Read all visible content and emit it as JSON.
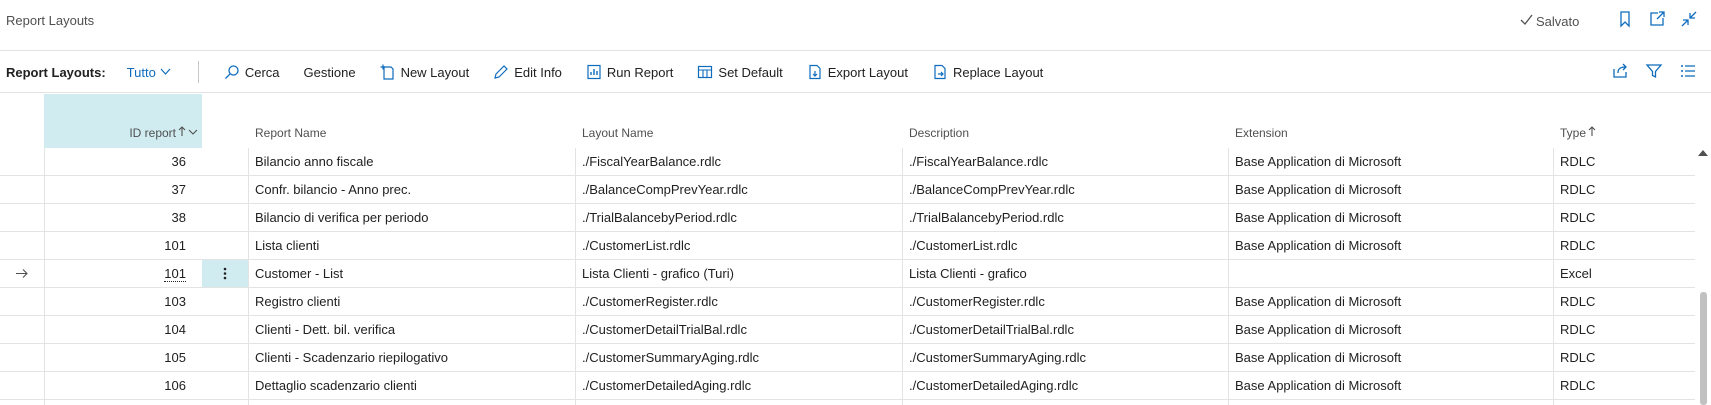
{
  "page": {
    "title": "Report Layouts",
    "saved_label": "Salvato"
  },
  "toolbar": {
    "caption": "Report Layouts:",
    "view": "Tutto",
    "actions": [
      "Cerca",
      "Gestione",
      "New Layout",
      "Edit Info",
      "Run Report",
      "Set Default",
      "Export Layout",
      "Replace Layout"
    ]
  },
  "columns": {
    "id": "ID report",
    "name": "Report Name",
    "layout": "Layout Name",
    "desc": "Description",
    "ext": "Extension",
    "type": "Type"
  },
  "rows": [
    {
      "id": "36",
      "name": "Bilancio anno fiscale",
      "layout": "./FiscalYearBalance.rdlc",
      "desc": "./FiscalYearBalance.rdlc",
      "ext": "Base Application di Microsoft",
      "type": "RDLC"
    },
    {
      "id": "37",
      "name": "Confr. bilancio - Anno prec.",
      "layout": "./BalanceCompPrevYear.rdlc",
      "desc": "./BalanceCompPrevYear.rdlc",
      "ext": "Base Application di Microsoft",
      "type": "RDLC"
    },
    {
      "id": "38",
      "name": "Bilancio di verifica per periodo",
      "layout": "./TrialBalancebyPeriod.rdlc",
      "desc": "./TrialBalancebyPeriod.rdlc",
      "ext": "Base Application di Microsoft",
      "type": "RDLC"
    },
    {
      "id": "101",
      "name": "Lista clienti",
      "layout": "./CustomerList.rdlc",
      "desc": "./CustomerList.rdlc",
      "ext": "Base Application di Microsoft",
      "type": "RDLC"
    },
    {
      "id": "101",
      "name": "Customer - List",
      "layout": "Lista Clienti - grafico (Turi)",
      "desc": "Lista Clienti - grafico",
      "ext": "",
      "type": "Excel"
    },
    {
      "id": "103",
      "name": "Registro clienti",
      "layout": "./CustomerRegister.rdlc",
      "desc": "./CustomerRegister.rdlc",
      "ext": "Base Application di Microsoft",
      "type": "RDLC"
    },
    {
      "id": "104",
      "name": "Clienti - Dett. bil. verifica",
      "layout": "./CustomerDetailTrialBal.rdlc",
      "desc": "./CustomerDetailTrialBal.rdlc",
      "ext": "Base Application di Microsoft",
      "type": "RDLC"
    },
    {
      "id": "105",
      "name": "Clienti - Scadenzario riepilogativo",
      "layout": "./CustomerSummaryAging.rdlc",
      "desc": "./CustomerSummaryAging.rdlc",
      "ext": "Base Application di Microsoft",
      "type": "RDLC"
    },
    {
      "id": "106",
      "name": "Dettaglio scadenzario clienti",
      "layout": "./CustomerDetailedAging.rdlc",
      "desc": "./CustomerDetailedAging.rdlc",
      "ext": "Base Application di Microsoft",
      "type": "RDLC"
    }
  ],
  "colors": {
    "accent": "#0f6cbd",
    "selected": "#d0ecf0",
    "border": "#e3e3e3"
  },
  "icons": [
    "checkmark-icon",
    "bookmark-icon",
    "open-new-window-icon",
    "collapse-icon",
    "search-icon",
    "new-document-icon",
    "edit-icon",
    "run-report-icon",
    "set-default-icon",
    "export-icon",
    "replace-icon",
    "share-icon",
    "filter-icon",
    "list-icon",
    "arrow-right-icon",
    "more-menu-icon"
  ]
}
